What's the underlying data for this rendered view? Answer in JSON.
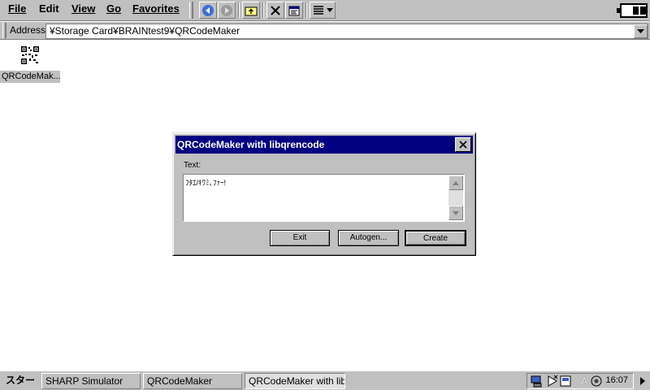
{
  "menubar": {
    "items": [
      {
        "label": "File"
      },
      {
        "label": "Edit"
      },
      {
        "label": "View"
      },
      {
        "label": "Go"
      },
      {
        "label": "Favorites"
      }
    ]
  },
  "toolbar": {
    "buttons": [
      "back-icon",
      "forward-icon",
      "up-folder-icon",
      "delete-icon",
      "properties-icon",
      "views-icon"
    ]
  },
  "address_bar": {
    "label": "Address",
    "value": "¥Storage Card¥BRAINtest9¥QRCodeMaker"
  },
  "desktop": {
    "file_label": "QRCodeMak..."
  },
  "dialog": {
    "title": "QRCodeMaker with libqrencode",
    "text_label": "Text:",
    "text_value": "ﾌﾀｴ/ｷﾜﾐ､ﾌｧｰ!",
    "buttons": {
      "exit": "Exit",
      "autogen": "Autogen...",
      "create": "Create"
    }
  },
  "taskbar": {
    "start": "スタート",
    "tasks": [
      {
        "label": "SHARP Simulator"
      },
      {
        "label": "QRCodeMaker"
      },
      {
        "label": "QRCodeMaker with libqrencode"
      }
    ],
    "tray_letter": "A",
    "clock": "16:07"
  },
  "colors": {
    "chrome": "#c0c0c0",
    "title_bar": "#000080",
    "desktop": "#ffffff"
  }
}
